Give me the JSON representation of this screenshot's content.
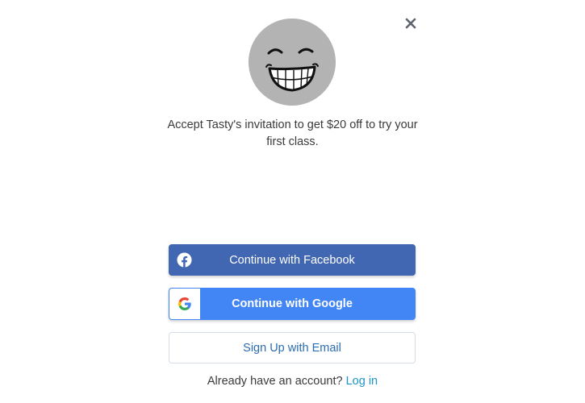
{
  "modal": {
    "close_icon": "close-icon",
    "avatar_icon": "smiley-face-icon",
    "invite_message": "Accept Tasty's invitation to get $20 off to try your first class.",
    "facebook_button": {
      "label": "Continue with Facebook",
      "icon": "facebook-icon",
      "color": "#4267b2"
    },
    "google_button": {
      "label": "Continue with Google",
      "icon": "google-icon",
      "color": "#4285f4"
    },
    "email_button": {
      "label": "Sign Up with Email",
      "color": "#2b6cb0"
    },
    "login_prompt": "Already have an account?",
    "login_link": "Log in",
    "link_color": "#1e95c9"
  }
}
